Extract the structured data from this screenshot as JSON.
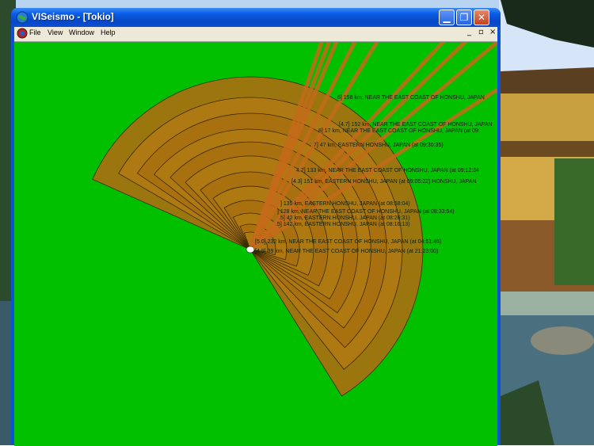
{
  "window": {
    "title": "VISeismo - [Tokio]",
    "min_label": "▁",
    "max_label": "❐",
    "close_label": "✕"
  },
  "menu": {
    "items": [
      "File",
      "View",
      "Window",
      "Help"
    ],
    "mdi_min": "_",
    "mdi_restore": "▫",
    "mdi_close": "×"
  },
  "canvas": {
    "background": "#00c000",
    "quakes": [
      {
        "label": "6] 158 km,  NEAR THE EAST COAST OF HONSHU, JAPAN"
      },
      {
        "label": "[4.7] 152 km,  NEAR THE EAST COAST OF HONSHU, JAPAN"
      },
      {
        "label": "8] 17 km,  NEAR THE EAST COAST OF HONSHU, JAPAN (at 09:"
      },
      {
        "label": "7] 47 km,  EASTERN HONSHU, JAPAN (at 09:30:35)"
      },
      {
        "label": "4.7] 133 km,  NEAR THE EAST COAST OF HONSHU, JAPAN (at 09:12:34"
      },
      {
        "label": "[4.3] 151 km,  EASTERN HONSHU, JAPAN (at 09:05:22)  HONSHU, JAPAN"
      },
      {
        "label": "] 135 km,  EASTERN HONSHU, JAPAN (at 08:58:04)"
      },
      {
        "label": "] 128 km,  NEAR THE EAST COAST OF HONSHU, JAPAN (at 08:33:54)"
      },
      {
        "label": ".5] 42 km,  EASTERN HONSHU, JAPAN (at 08:26:31)"
      },
      {
        "label": ".5] 142 km,  EASTERN HONSHU, JAPAN (at 08:16:13)"
      },
      {
        "label": "[5.0] 232 km,  NEAR THE EAST COAST OF HONSHU, JAPAN (at 04:51:46)"
      },
      {
        "label": "[4.9] 39 km,  NEAR THE EAST COAST OF HONSHU, JAPAN (at 21:23:00)"
      }
    ]
  },
  "colors": {
    "title_bar": "#0a5ee6",
    "client_bg": "#00c000",
    "wedge_fill": "#a87010",
    "wedge_stroke": "#3a2a00",
    "ray": "#c46a1a"
  }
}
